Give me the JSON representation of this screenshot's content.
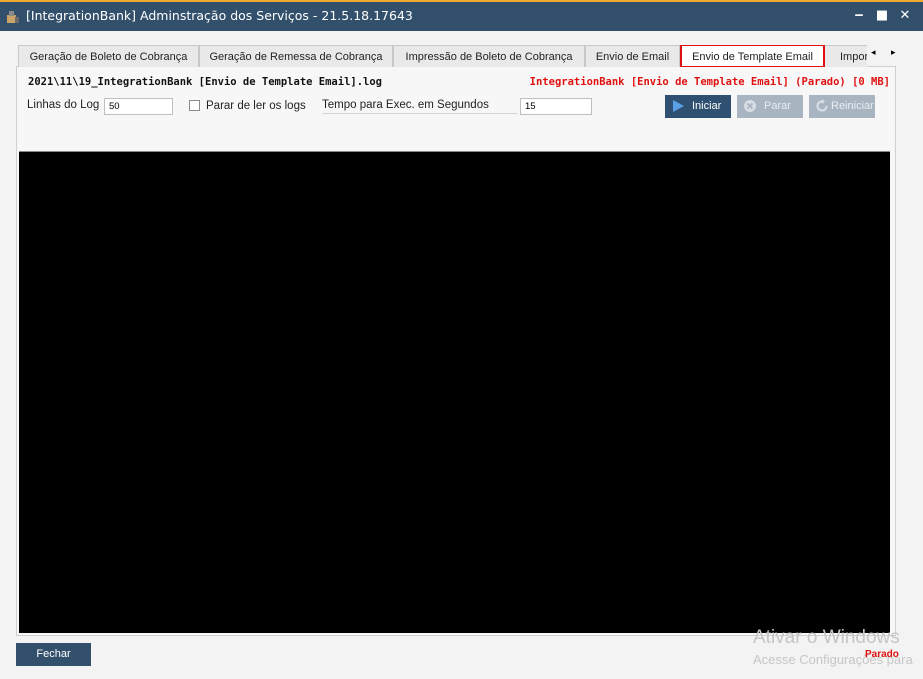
{
  "window": {
    "title": "[IntegrationBank] Adminstração dos Serviços - 21.5.18.17643",
    "minimize": "‒",
    "maximize": "■",
    "close": "✕",
    "accent": "#f0a830",
    "titlebar_color": "#32506b"
  },
  "tabs": [
    {
      "label": "Geração de Boleto de Cobrança"
    },
    {
      "label": "Geração de Remessa de Cobrança"
    },
    {
      "label": "Impressão de Boleto de Cobrança"
    },
    {
      "label": "Envio de Email"
    },
    {
      "label": "Envio de Template Email",
      "active": true
    },
    {
      "label": "Impor"
    }
  ],
  "tab_scroll": {
    "left": "◂",
    "right": "▸"
  },
  "log": {
    "file": "2021\\11\\19_IntegrationBank [Envio de Template Email].log",
    "service_status": "IntegrationBank [Envio de Template Email] (Parado) [0 MB]"
  },
  "controls": {
    "linhas_label": "Linhas do Log",
    "linhas_value": "50",
    "parar_label": "Parar de ler os logs",
    "tempo_label": "Tempo para Exec. em Segundos",
    "tempo_value": "15"
  },
  "buttons": {
    "iniciar": "Iniciar",
    "parar": "Parar",
    "reiniciar": "Reiniciar",
    "fechar": "Fechar"
  },
  "status": "Parado",
  "watermark": {
    "line1": "Ativar o Windows",
    "line2": "Acesse Configurações para"
  },
  "colors": {
    "status_red": "#e01010",
    "console_bg": "#000000"
  }
}
